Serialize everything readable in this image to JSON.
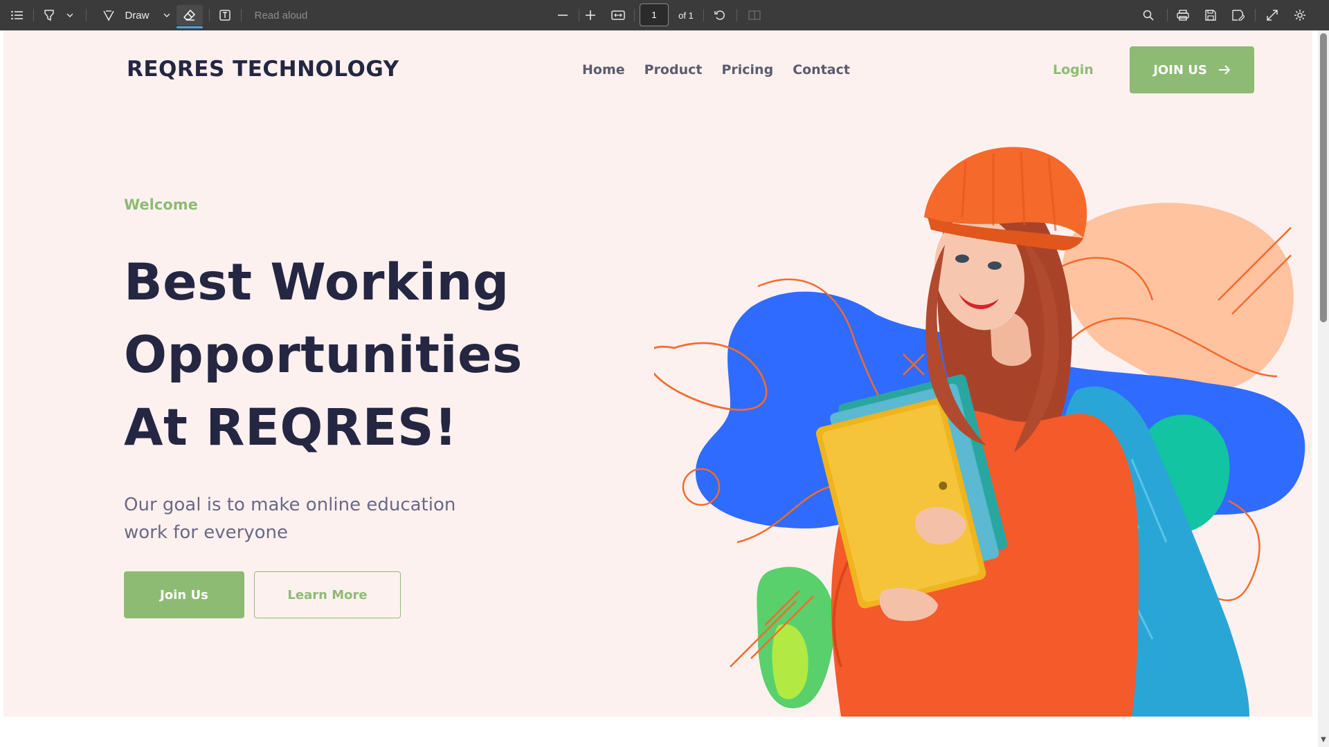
{
  "toolbar": {
    "draw_label": "Draw",
    "read_aloud_label": "Read aloud",
    "page_current": "1",
    "page_total": "of 1",
    "icons": [
      "contents-icon",
      "highlight-icon",
      "chevron-down-icon",
      "draw-icon",
      "chevron-down-icon",
      "eraser-icon",
      "text-box-icon",
      "zoom-out-icon",
      "zoom-in-icon",
      "fit-page-icon",
      "rotate-icon",
      "two-page-icon",
      "search-icon",
      "print-icon",
      "save-icon",
      "save-as-icon",
      "fullscreen-icon",
      "settings-icon"
    ]
  },
  "site": {
    "brand": "REQRES TECHNOLOGY",
    "nav": [
      "Home",
      "Product",
      "Pricing",
      "Contact"
    ],
    "login": "Login",
    "join_top": "JOIN US",
    "welcome": "Welcome",
    "headline": [
      "Best Working",
      "Opportunities",
      "At REQRES!"
    ],
    "subtitle": "Our goal is to make online education work for everyone",
    "btn_join": "Join Us",
    "btn_learn": "Learn More"
  },
  "colors": {
    "accent_green": "#8dbb73",
    "navy_text": "#252641",
    "hero_bg": "#fdf1f0",
    "blob_blue": "#2f6bff",
    "blob_peach": "#ffc3a0",
    "sweater_orange": "#f45a2a"
  }
}
